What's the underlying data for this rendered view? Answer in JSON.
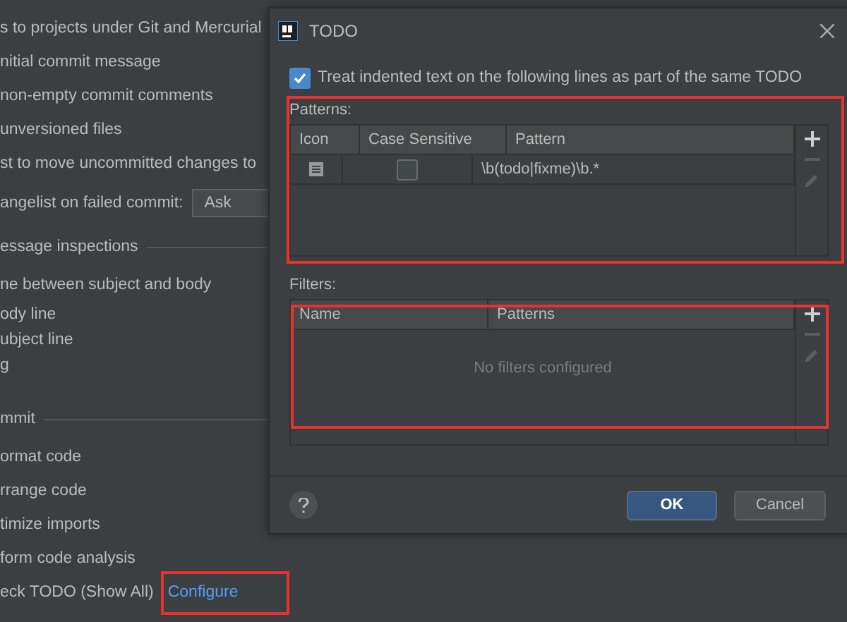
{
  "background_settings": {
    "lines": [
      {
        "kind": "text",
        "text": "s to projects under Git and Mercurial"
      },
      {
        "kind": "text",
        "text": "nitial commit message"
      },
      {
        "kind": "text",
        "text": "non-empty commit comments"
      },
      {
        "kind": "text",
        "text": "unversioned files"
      },
      {
        "kind": "text",
        "text": "st to move uncommitted changes to"
      },
      {
        "kind": "dropdown",
        "text": "angelist on failed commit:",
        "value": "Ask"
      },
      {
        "kind": "section",
        "text": "essage inspections"
      },
      {
        "kind": "text",
        "text": "ne between subject and body"
      },
      {
        "kind": "compact",
        "text": "ody line"
      },
      {
        "kind": "compact",
        "text": "ubject line"
      },
      {
        "kind": "compact",
        "text": "g"
      },
      {
        "kind": "section",
        "text": "mmit"
      },
      {
        "kind": "text",
        "text": "ormat code"
      },
      {
        "kind": "text",
        "text": "rrange code"
      },
      {
        "kind": "text",
        "text": "timize imports"
      },
      {
        "kind": "text",
        "text": "form code analysis"
      },
      {
        "kind": "link",
        "text": "eck TODO (Show All)",
        "link": "Configure"
      }
    ]
  },
  "dialog": {
    "title": "TODO",
    "checkbox": {
      "label": "Treat indented text on the following lines as part of the same TODO",
      "checked": true
    },
    "patterns": {
      "label": "Patterns:",
      "columns": [
        "Icon",
        "Case Sensitive",
        "Pattern"
      ],
      "rows": [
        {
          "case_sensitive": false,
          "pattern": "\\b(todo|fixme)\\b.*"
        }
      ]
    },
    "filters": {
      "label": "Filters:",
      "columns": [
        "Name",
        "Patterns"
      ],
      "empty_text": "No filters configured"
    },
    "buttons": [
      {
        "label": "OK",
        "kind": "primary"
      },
      {
        "label": "Cancel",
        "kind": "secondary"
      }
    ]
  }
}
